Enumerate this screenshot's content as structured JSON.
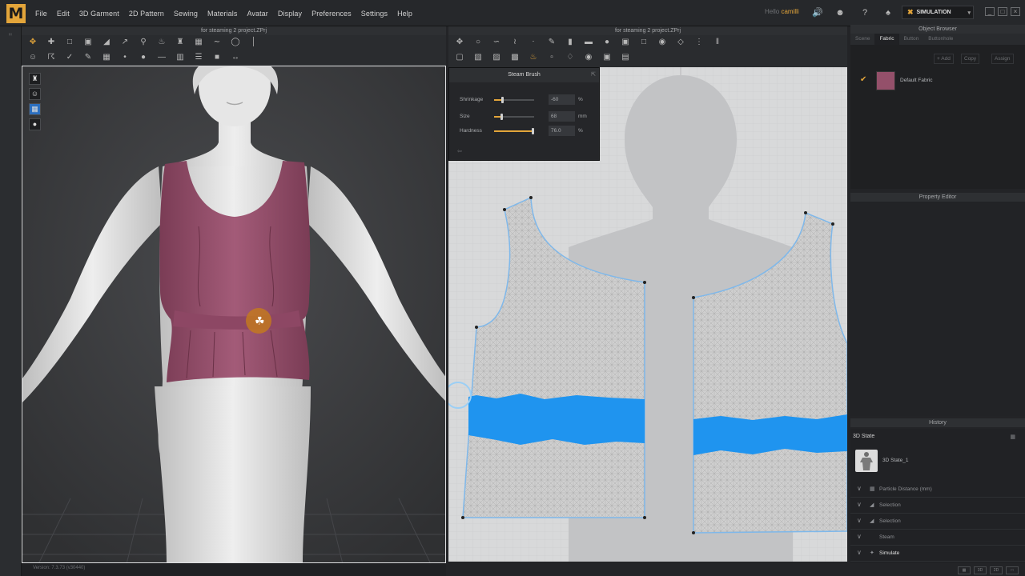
{
  "app": {
    "logo_letter": "M",
    "menus": [
      "File",
      "Edit",
      "3D Garment",
      "2D Pattern",
      "Sewing",
      "Materials",
      "Avatar",
      "Display",
      "Preferences",
      "Settings",
      "Help"
    ],
    "user_label": "Hello",
    "user_name": "camilli",
    "mode": "SIMULATION",
    "accent_color": "#e3a53a"
  },
  "panel3d": {
    "title": "for steaming 2 project.ZPrj",
    "status": "Version: 7.3.73   (v30440)"
  },
  "panel2d": {
    "title": "for steaming 2 project.ZPrj"
  },
  "steam_brush": {
    "title": "Steam Brush",
    "params": [
      {
        "label": "Shrinkage",
        "value": "-60",
        "unit": "%",
        "level": 0.2
      },
      {
        "label": "Size",
        "value": "68",
        "unit": "mm",
        "level": 0.18
      },
      {
        "label": "Hardness",
        "value": "76.0",
        "unit": "%",
        "level": 0.95
      }
    ]
  },
  "object_browser": {
    "title": "Object Browser",
    "tabs": [
      "Scene",
      "Fabric",
      "Button",
      "Buttonhole"
    ],
    "active_tab": "Fabric",
    "actions": [
      "+ Add",
      "Copy",
      "Assign"
    ],
    "fabric_name": "Default Fabric",
    "fabric_color": "#94506a"
  },
  "property_editor": {
    "title": "Property Editor"
  },
  "history": {
    "title": "History",
    "state_label": "3D State",
    "state_item": "3D State_1",
    "items": [
      "Particle Distance (mm)",
      "Selection",
      "Selection",
      "Steam",
      "Simulate"
    ]
  }
}
